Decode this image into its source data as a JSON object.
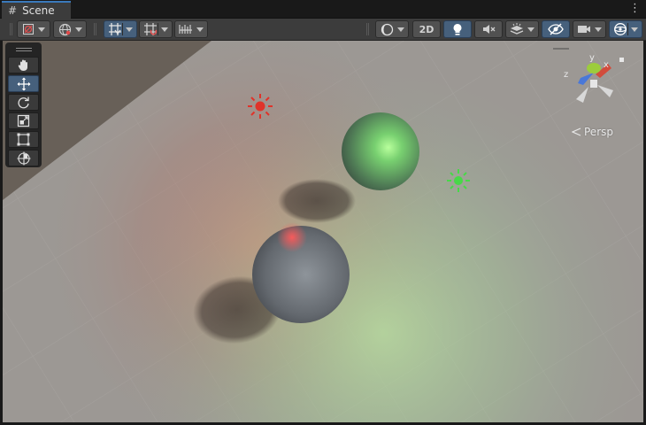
{
  "tab": {
    "label": "Scene",
    "icon": "grid-icon"
  },
  "tab_menu_glyph": "⋮",
  "toolbar": {
    "draw_mode_icon": "draw-mode-icon",
    "global_icon": "globe-icon",
    "grid_snapping_icon": "grid-snapping-icon",
    "increment_snap_icon": "increment-snap-icon",
    "ruler_icon": "ruler-icon",
    "shading_icon": "shading-sphere-icon",
    "mode_2d_label": "2D",
    "lighting_icon": "lightbulb-icon",
    "audio_icon": "audio-mute-icon",
    "effects_icon": "effects-layers-icon",
    "visibility_icon": "hidden-eye-icon",
    "camera_icon": "camera-icon",
    "gizmos_icon": "gizmos-globe-icon"
  },
  "tools": [
    {
      "name": "view-tool-hand",
      "icon": "hand-icon"
    },
    {
      "name": "move-tool",
      "icon": "move-arrows-icon",
      "active": true
    },
    {
      "name": "rotate-tool",
      "icon": "rotate-icon"
    },
    {
      "name": "scale-tool",
      "icon": "scale-icon"
    },
    {
      "name": "rect-tool",
      "icon": "rect-transform-icon"
    },
    {
      "name": "transform-tool",
      "icon": "transform-icon"
    }
  ],
  "gizmo": {
    "axis_y": "y",
    "axis_x": "x",
    "axis_z": "z",
    "projection_label": "Persp",
    "colors": {
      "x": "#d24c3c",
      "y": "#9ccc3c",
      "z": "#4a78d8"
    }
  },
  "scene": {
    "lights": [
      {
        "name": "red-point-light",
        "color": "#e0332a"
      },
      {
        "name": "green-point-light",
        "color": "#48d848"
      }
    ],
    "spheres": [
      {
        "name": "green-lit-sphere"
      },
      {
        "name": "grey-sphere"
      }
    ]
  }
}
